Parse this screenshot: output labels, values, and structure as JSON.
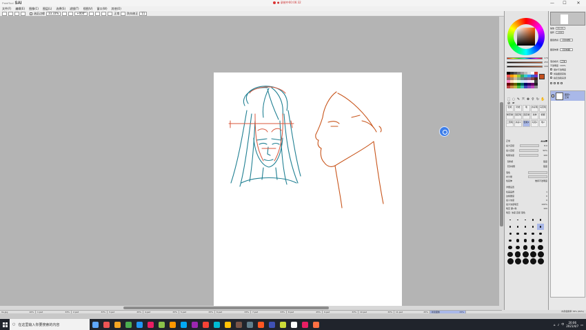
{
  "titlebar": {
    "app_name": "SAI",
    "app_prefix": "PaintTool",
    "recording": "● 录制中00:06:32",
    "minimize": "—",
    "maximize": "☐",
    "close": "✕"
  },
  "menu": [
    "文件(F)",
    "编辑(E)",
    "图像(C)",
    "图层(L)",
    "选择(S)",
    "滤镜(T)",
    "视图(V)",
    "窗口(W)",
    "其他(O)"
  ],
  "toolbar": {
    "antialias_label": "选区边缘",
    "zoom_value": "33.33%",
    "rotate_value": "+000°",
    "blend_label": "正常",
    "stabilizer_label": "防抖修正",
    "stabilizer_value": "11"
  },
  "color_panel": {
    "sliders": [
      {
        "value": "170"
      },
      {
        "value": "255"
      },
      {
        "value": "100"
      }
    ],
    "main_color": "#c4511e"
  },
  "tools": {
    "icons": [
      "⬚",
      "◌",
      "✎",
      "⤧",
      "✥",
      "⚲",
      "↻",
      "✋",
      "⊘",
      "✒"
    ],
    "brushes": [
      "铅笔",
      "喷枪",
      "笔",
      "水彩笔",
      "马克笔",
      "橡皮擦",
      "选区笔",
      "选区擦",
      "涂抹",
      "模糊",
      "二值笔",
      "水彩2",
      "铅笔2",
      "马克2",
      "笔2"
    ]
  },
  "brush_params": {
    "blend_mode": "正常",
    "max_size_label": "最大直径",
    "max_size_value": "8.0",
    "min_size_label": "最小直径",
    "min_size_value": "50%",
    "density_label": "笔刷浓度",
    "density_value": "100",
    "shape_label": "【通常】",
    "shape_value": "强度",
    "texture_label": "【无材质】",
    "texture_value": "强度",
    "blend_label": "混色",
    "water_label": "水分量",
    "color_extend_label": "色延伸",
    "keep_opacity_label": "维持不透明度",
    "detail_label": "详细设置",
    "pressure_label": "绘画品质",
    "pressure_value": "1",
    "edge_label": "边缘硬度",
    "edge_value": "0",
    "min_density_label": "最小浓度",
    "min_density_value": "0",
    "max_density_label": "最大浓度笔压",
    "max_density_value": "100%",
    "pen_pressure_label": "笔压 硬↔软",
    "pen_pressure_value": "100",
    "pressure_options": "笔压: 浓度 直径 混色"
  },
  "brush_sizes": [
    "0.7",
    "0.8",
    "1",
    "1.5",
    "2",
    "2.3",
    "2.6",
    "3",
    "3.5",
    "4",
    "5",
    "6",
    "7",
    "8",
    "9",
    "10",
    "12",
    "14",
    "16",
    "20",
    "25",
    "30",
    "35",
    "40",
    "50",
    "60",
    "70",
    "80",
    "100",
    "120",
    "160",
    "200",
    "250",
    "300",
    "350"
  ],
  "brush_size_selected": "4",
  "layers": {
    "zoom_label": "缩放",
    "zoom_value": "33.3%",
    "rotate_label": "旋转",
    "rotate_value": "+000",
    "paper_texture_label": "图层质感",
    "paper_texture_value": "【无材质】",
    "paper_effect_label": "图层效果",
    "paper_effect_value": "【无效果】",
    "blend_label": "混合模式",
    "blend_value": "正常",
    "opacity_label": "不透明度",
    "opacity_value": "100%",
    "protect_alpha_label": "保护不透明度",
    "clip_label": "剪贴图层蒙版",
    "reference_label": "指定选取来源",
    "layer_name": "图层1",
    "layer_mode": "正常"
  },
  "doc_tabs": [
    {
      "name": "0e.jpg",
      "zoom": "10%"
    },
    {
      "name": "1.psd",
      "zoom": "33%"
    },
    {
      "name": "2.psd",
      "zoom": "33%"
    },
    {
      "name": "3.psd",
      "zoom": "25%"
    },
    {
      "name": "4.psd",
      "zoom": "33%"
    },
    {
      "name": "5.psd",
      "zoom": "33%"
    },
    {
      "name": "6.psd",
      "zoom": "33%"
    },
    {
      "name": "7.psd",
      "zoom": "33%"
    },
    {
      "name": "8.psd",
      "zoom": "25%"
    },
    {
      "name": "9.psd",
      "zoom": "33%"
    },
    {
      "name": "10.psd",
      "zoom": "33%"
    },
    {
      "name": "11.psd",
      "zoom": "25%"
    },
    {
      "name": "新建图像",
      "zoom": "33%"
    }
  ],
  "statusbar": "内存使用率 78% (84%)",
  "taskbar": {
    "search_placeholder": "在这里输入你要搜索的内容",
    "time": "20:06",
    "date": "2021/4/7",
    "lang": "中",
    "icon_colors": [
      "#5fa8ff",
      "#e55",
      "#f5a623",
      "#4caf50",
      "#2196f3",
      "#e91e63",
      "#8bc34a",
      "#ff9800",
      "#03a9f4",
      "#9c27b0",
      "#f44336",
      "#00bcd4",
      "#ffc107",
      "#795548",
      "#607d8b",
      "#ff5722",
      "#3f51b5",
      "#cddc39",
      "#ffffff",
      "#e91e63",
      "#ff7043"
    ]
  },
  "sketch_colors": {
    "teal": "#1f7f92",
    "red": "#d8553a",
    "orange": "#c8541a"
  }
}
